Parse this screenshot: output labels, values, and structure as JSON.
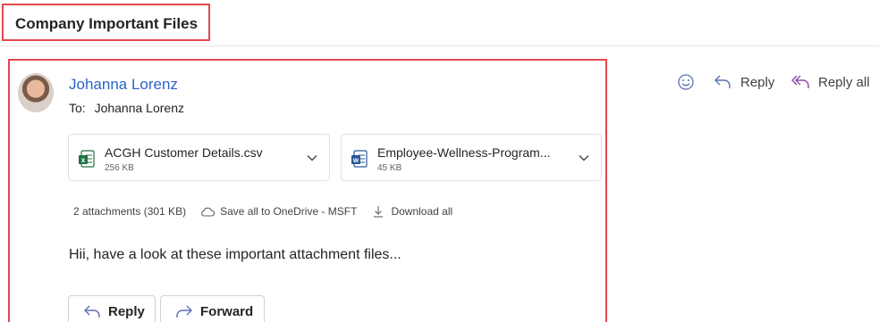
{
  "subject": "Company Important Files",
  "message": {
    "sender": "Johanna Lorenz",
    "to_label": "To:",
    "to_value": "Johanna Lorenz",
    "body": "Hii, have a look at these important attachment files..."
  },
  "attachments": [
    {
      "name": "ACGH Customer Details.csv",
      "size": "256 KB",
      "icon": "excel-file-icon",
      "color": "#1e7145"
    },
    {
      "name": "Employee-Wellness-Program...",
      "size": "45 KB",
      "icon": "word-file-icon",
      "color": "#2b5797"
    }
  ],
  "summary": {
    "count": "2 attachments (301 KB)",
    "save_all": "Save all to OneDrive - MSFT",
    "download_all": "Download all"
  },
  "toolbar": {
    "reply": "Reply",
    "reply_all": "Reply all"
  },
  "actions": {
    "reply": "Reply",
    "forward": "Forward"
  },
  "colors": {
    "highlight_border": "#e5474d",
    "sender_link": "#2b63c6",
    "reply_icon": "#5a6fb5",
    "reply_all_icon": "#8a4aa8"
  }
}
